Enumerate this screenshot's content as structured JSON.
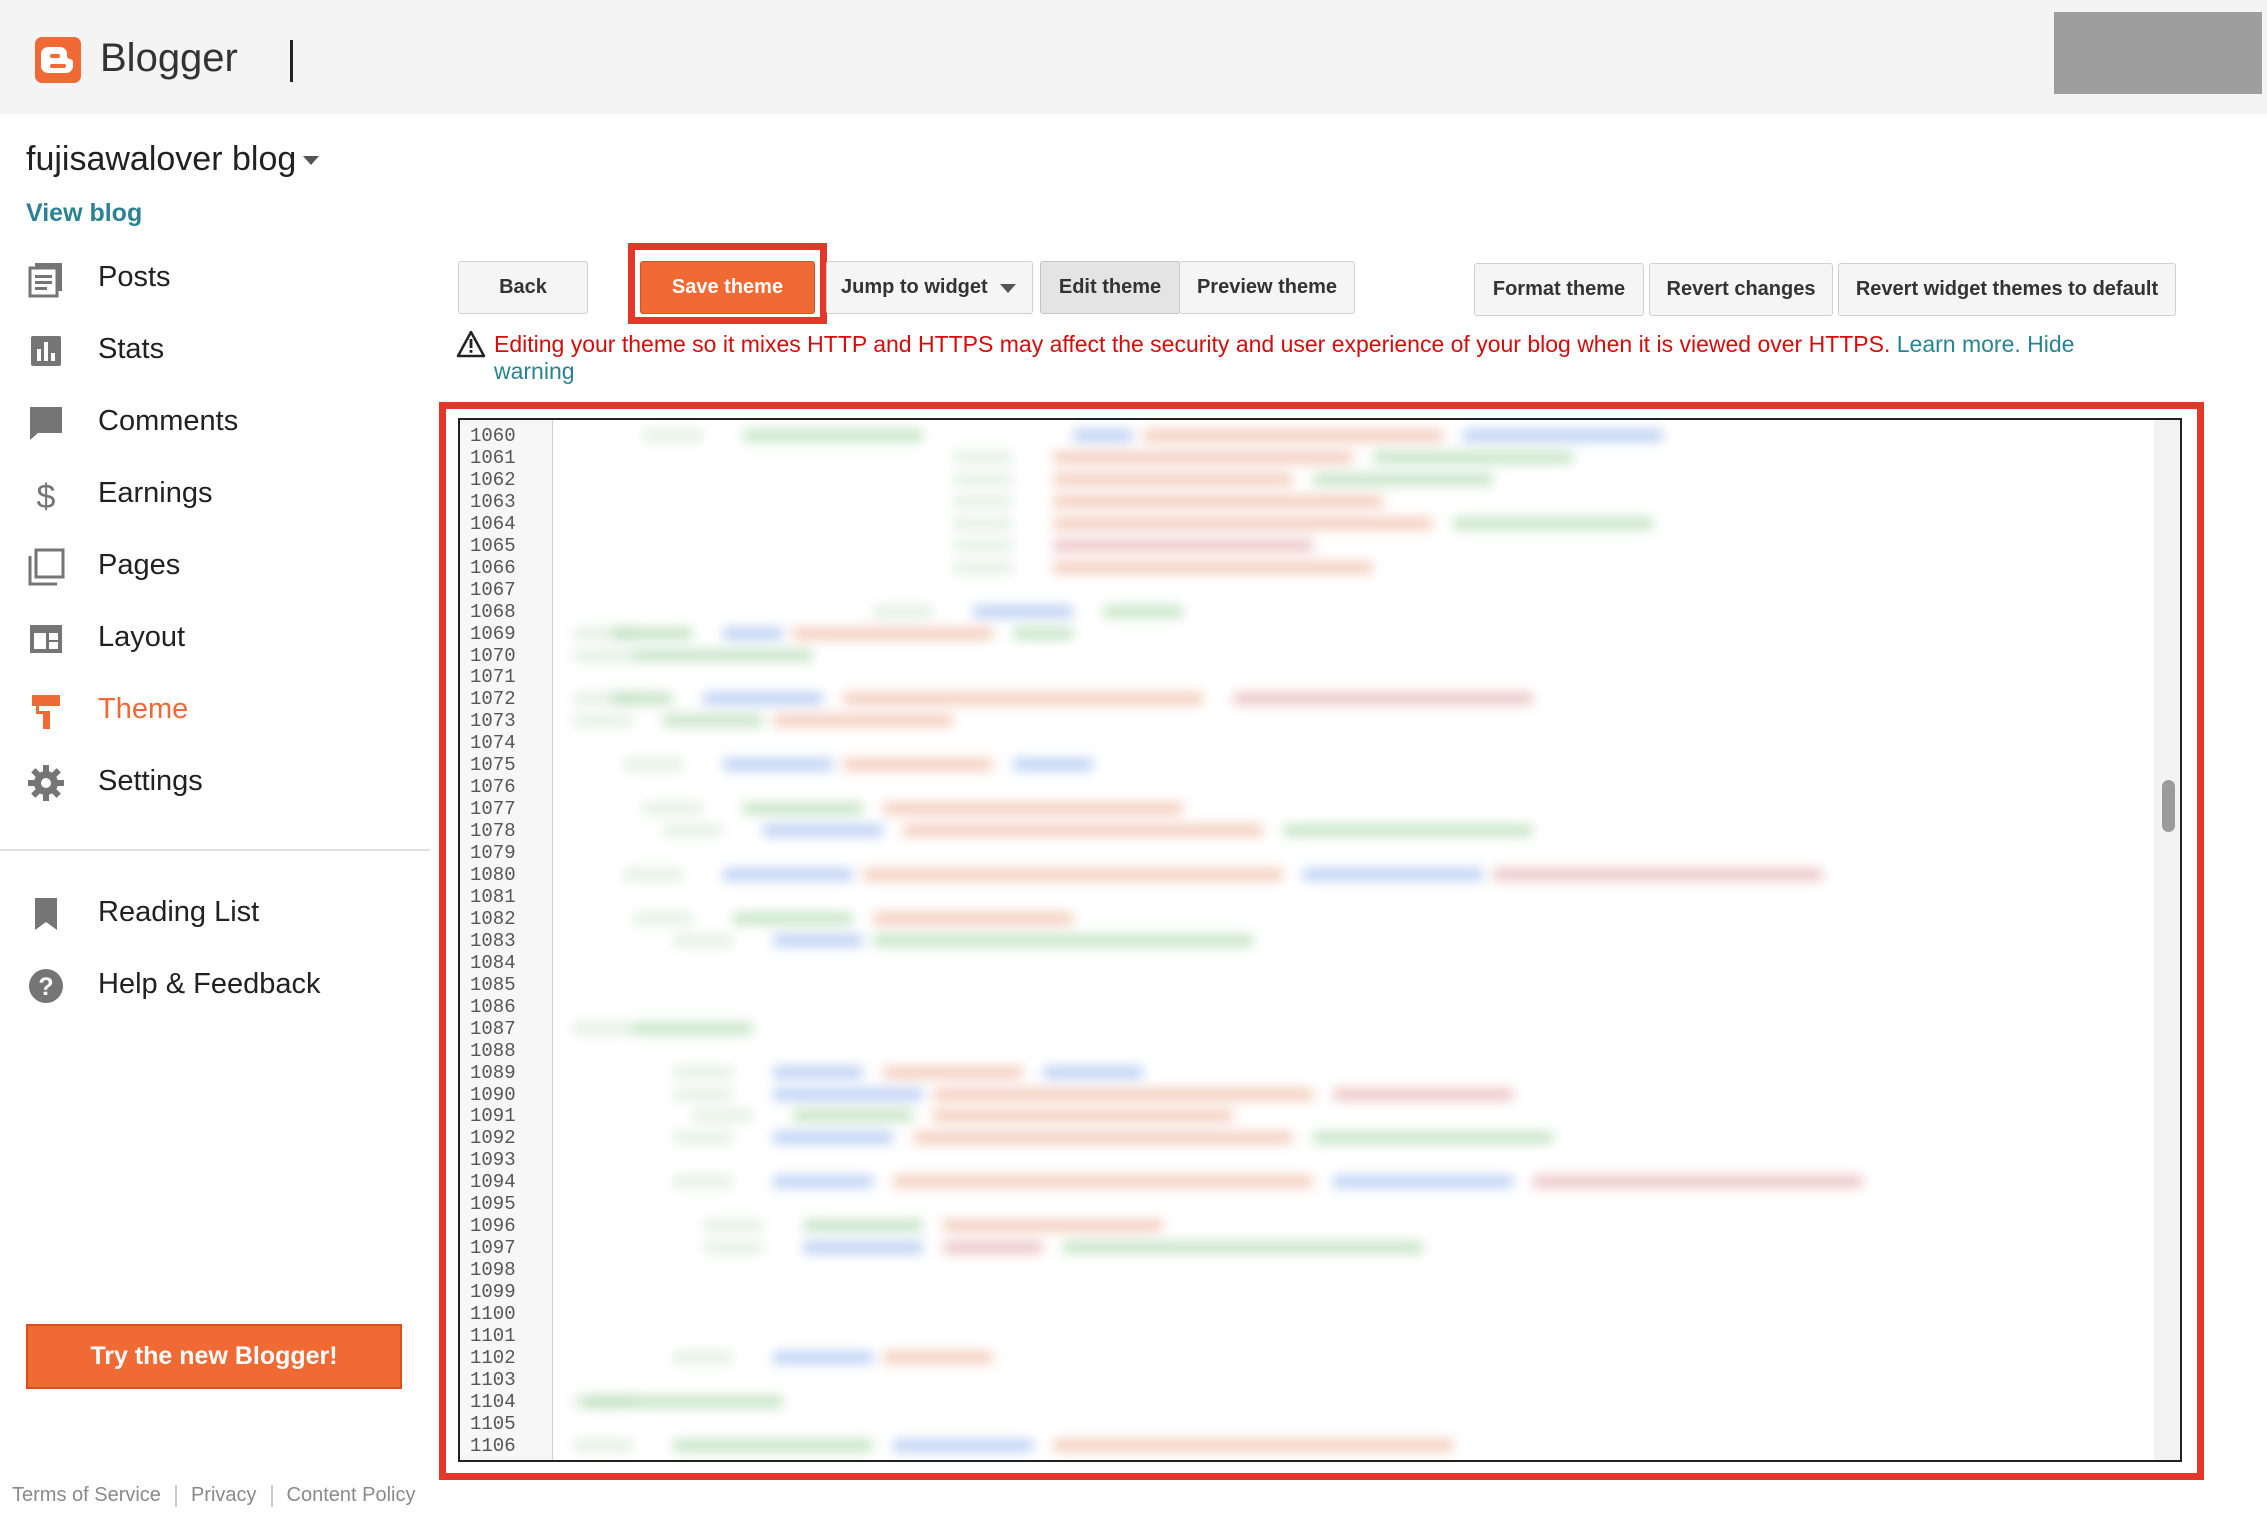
{
  "header": {
    "brand": "Blogger"
  },
  "sidebar": {
    "blog_title": "fujisawalover blog",
    "view_blog": "View blog",
    "items": [
      {
        "label": "Posts",
        "icon": "posts-icon"
      },
      {
        "label": "Stats",
        "icon": "stats-icon"
      },
      {
        "label": "Comments",
        "icon": "comments-icon"
      },
      {
        "label": "Earnings",
        "icon": "dollar-icon"
      },
      {
        "label": "Pages",
        "icon": "pages-icon"
      },
      {
        "label": "Layout",
        "icon": "layout-icon"
      },
      {
        "label": "Theme",
        "icon": "paint-roller-icon",
        "active": true
      },
      {
        "label": "Settings",
        "icon": "gear-icon"
      }
    ],
    "secondary": [
      {
        "label": "Reading List",
        "icon": "bookmark-icon"
      },
      {
        "label": "Help & Feedback",
        "icon": "help-icon"
      }
    ],
    "try_button": "Try the new Blogger!",
    "footer": [
      "Terms of Service",
      "Privacy",
      "Content Policy"
    ]
  },
  "toolbar": {
    "back": "Back",
    "save": "Save theme",
    "jump": "Jump to widget",
    "edit": "Edit theme",
    "preview": "Preview theme",
    "format": "Format theme",
    "revert": "Revert changes",
    "revert_widgets": "Revert widget themes to default"
  },
  "warning": {
    "text": "Editing your theme so it mixes HTTP and HTTPS may affect the security and user experience of your blog when it is viewed over HTTPS.",
    "learn_more": "Learn more.",
    "hide": "Hide warning"
  },
  "editor": {
    "line_start": 1060,
    "line_end": 1106
  },
  "colors": {
    "accent": "#f06a35",
    "link": "#2a8293",
    "warning": "#d30c0c",
    "highlight": "#e5362a"
  }
}
